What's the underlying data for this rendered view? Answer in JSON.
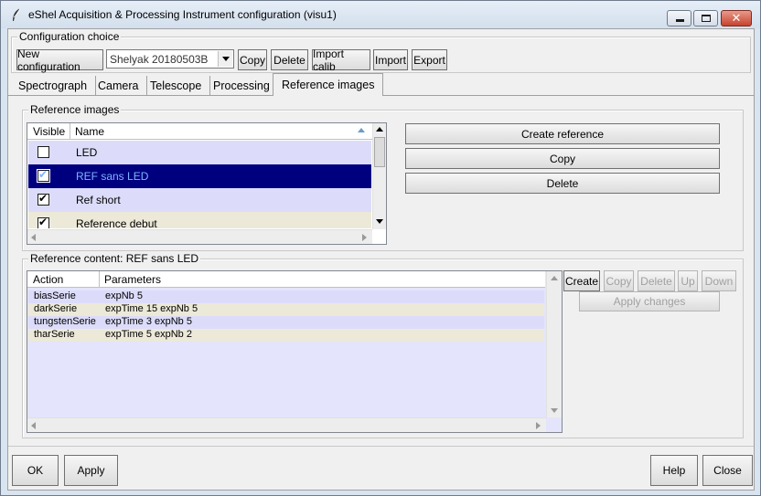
{
  "window": {
    "title": "eShel Acquisition & Processing Instrument configuration (visu1)"
  },
  "config": {
    "legend": "Configuration choice",
    "new_label": "New configuration",
    "selected": "Shelyak 20180503B",
    "copy_label": "Copy",
    "delete_label": "Delete",
    "import_calib_label": "Import calib",
    "import_label": "Import",
    "export_label": "Export"
  },
  "tabs": [
    {
      "label": "Spectrograph"
    },
    {
      "label": "Camera"
    },
    {
      "label": "Telescope"
    },
    {
      "label": "Processing"
    },
    {
      "label": "Reference images"
    }
  ],
  "ref_images": {
    "legend": "Reference images",
    "columns": {
      "visible": "Visible",
      "name": "Name"
    },
    "rows": [
      {
        "name": "LED",
        "visible": false
      },
      {
        "name": "REF sans LED",
        "visible": true
      },
      {
        "name": "Ref short",
        "visible": true
      },
      {
        "name": "Reference debut",
        "visible": true
      }
    ],
    "create_label": "Create reference",
    "copy_label": "Copy",
    "delete_label": "Delete"
  },
  "ref_content": {
    "legend": "Reference content: REF sans LED",
    "columns": {
      "action": "Action",
      "parameters": "Parameters"
    },
    "rows": [
      {
        "action": "biasSerie",
        "params": "expNb 5"
      },
      {
        "action": "darkSerie",
        "params": "expTime 15 expNb 5"
      },
      {
        "action": "tungstenSerie",
        "params": "expTime 3 expNb 5"
      },
      {
        "action": "tharSerie",
        "params": "expTime 5 expNb 2"
      }
    ],
    "create_label": "Create",
    "copy_label": "Copy",
    "delete_label": "Delete",
    "up_label": "Up",
    "down_label": "Down",
    "apply_changes_label": "Apply changes"
  },
  "footer": {
    "ok_label": "OK",
    "apply_label": "Apply",
    "help_label": "Help",
    "close_label": "Close"
  },
  "colors": {
    "selection": "#00007f",
    "row_alt": "#dcdcfa",
    "list_bg": "#e4e4fc"
  }
}
